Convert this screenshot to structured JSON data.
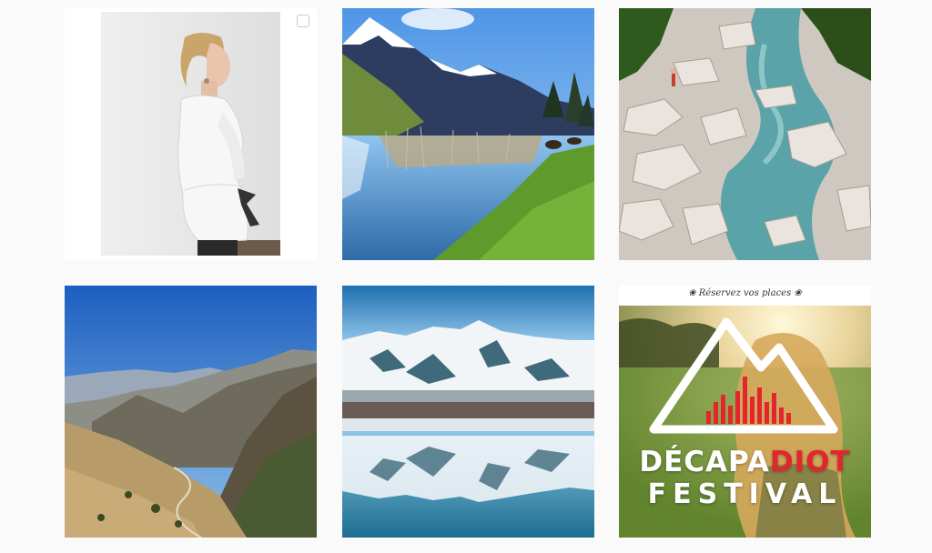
{
  "grid": {
    "tiles": [
      {
        "name": "woman-white-blouse"
      },
      {
        "name": "mountain-lake-reeds"
      },
      {
        "name": "rocky-river"
      },
      {
        "name": "mountain-valley"
      },
      {
        "name": "snowy-mountain-reflection"
      },
      {
        "name": "festival-poster"
      }
    ]
  },
  "festival": {
    "tagline": "❀ Réservez vos places ❀",
    "name_white": "DÉCAPA",
    "name_red": "DIOT",
    "subtitle": "FESTIVAL"
  },
  "colors": {
    "background": "#fafafa",
    "festival_red": "#e3262e"
  }
}
